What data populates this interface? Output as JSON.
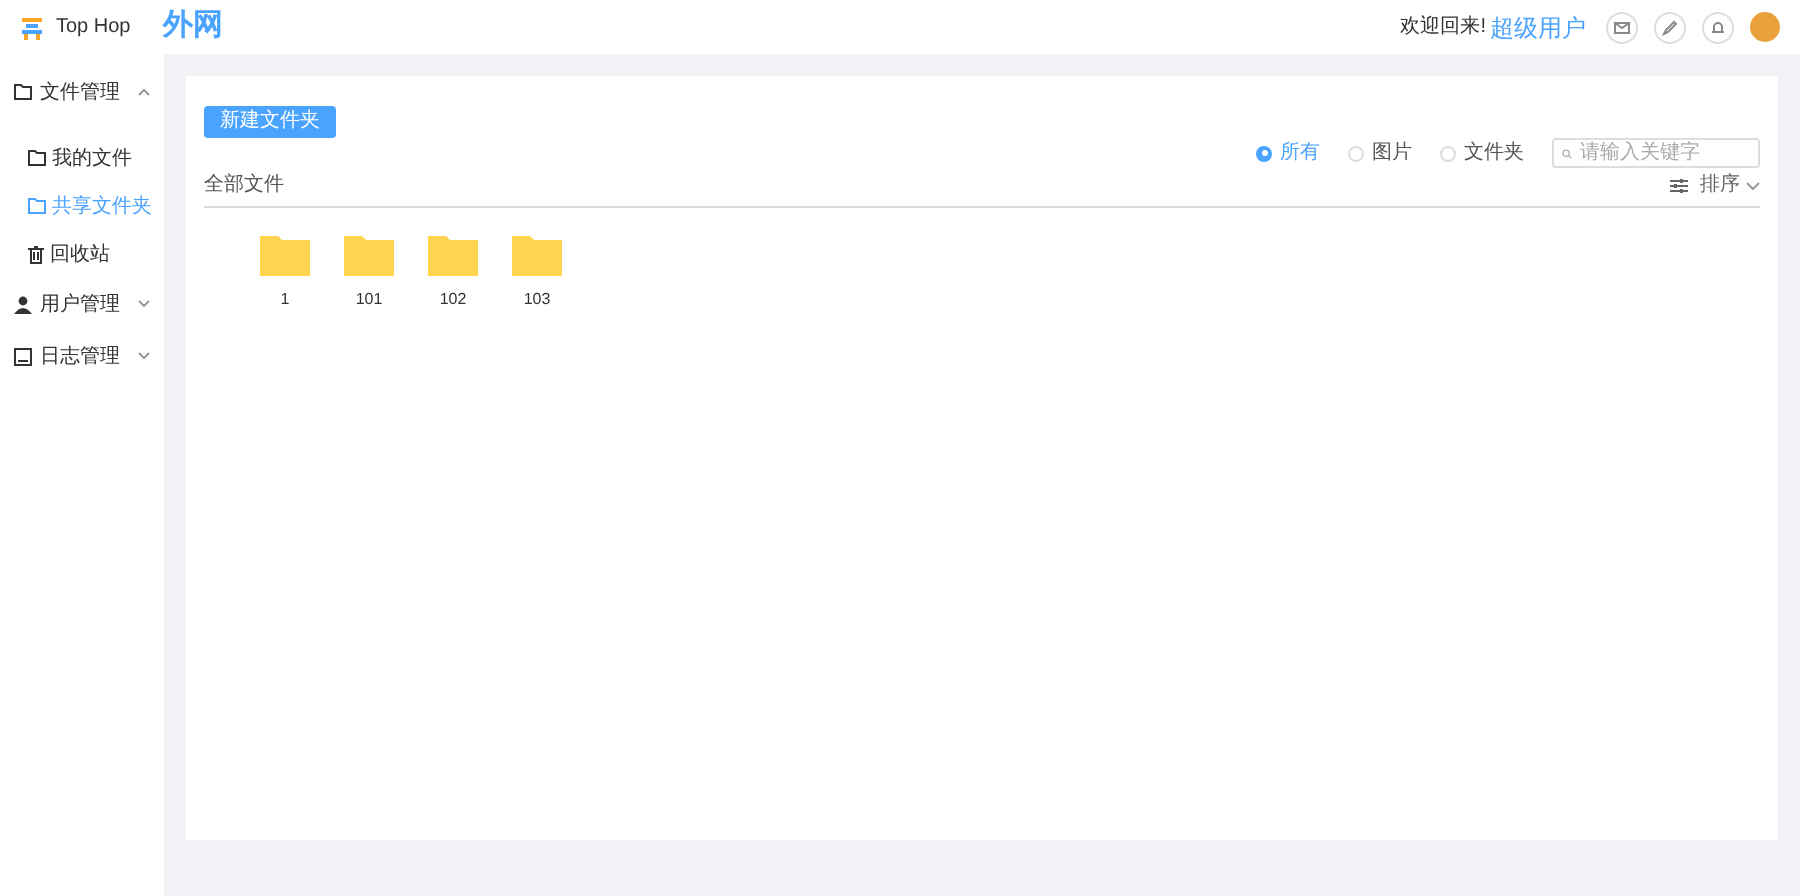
{
  "header": {
    "logo_text": "Top Hop",
    "title": "外网",
    "welcome": "欢迎回来!",
    "user_name": "超级用户"
  },
  "sidebar": {
    "items": [
      {
        "label": "文件管理",
        "kind": "folder",
        "expanded": true,
        "children": [
          {
            "label": "我的文件",
            "kind": "folder",
            "selected": false
          },
          {
            "label": "共享文件夹",
            "kind": "folder",
            "selected": true
          },
          {
            "label": "回收站",
            "kind": "trash",
            "selected": false
          }
        ]
      },
      {
        "label": "用户管理",
        "kind": "user",
        "expanded": false
      },
      {
        "label": "日志管理",
        "kind": "log",
        "expanded": false
      }
    ]
  },
  "toolbar": {
    "new_folder_button": "新建文件夹",
    "filters": [
      {
        "label": "所有",
        "selected": true
      },
      {
        "label": "图片",
        "selected": false
      },
      {
        "label": "文件夹",
        "selected": false
      }
    ],
    "search": {
      "placeholder": "请输入关键字"
    },
    "sort": "排序"
  },
  "breadcrumb": "全部文件",
  "folders": [
    {
      "name": "1"
    },
    {
      "name": "101"
    },
    {
      "name": "102"
    },
    {
      "name": "103"
    }
  ]
}
